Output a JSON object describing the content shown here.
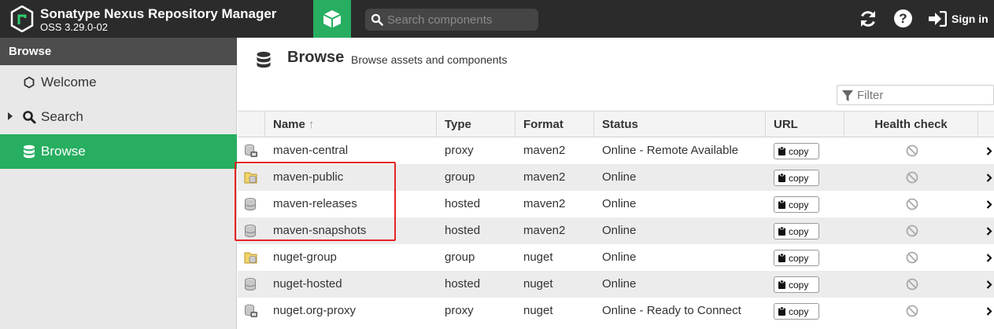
{
  "header": {
    "app_title": "Sonatype Nexus Repository Manager",
    "app_version": "OSS 3.29.0-02",
    "search_placeholder": "Search components",
    "signin_label": "Sign in",
    "help_label": "?",
    "accent_color": "#27ae60",
    "icons": {
      "logo": "nexus-logo-icon",
      "browse_mode": "cube-icon",
      "search": "search-icon",
      "refresh": "refresh-icon",
      "help": "help-icon",
      "signin": "sign-in-icon"
    }
  },
  "sidebar": {
    "header": "Browse",
    "items": [
      {
        "label": "Welcome",
        "icon": "hexagon-icon",
        "active": false
      },
      {
        "label": "Search",
        "icon": "search-icon",
        "active": false,
        "expandable": true
      },
      {
        "label": "Browse",
        "icon": "database-icon",
        "active": true
      }
    ]
  },
  "main": {
    "title": "Browse",
    "subtitle": "Browse assets and components",
    "filter_placeholder": "Filter",
    "columns": [
      "Name",
      "Type",
      "Format",
      "Status",
      "URL",
      "Health check"
    ],
    "sort_indicator": "↑",
    "copy_label": "copy",
    "rows": [
      {
        "name": "maven-central",
        "type": "proxy",
        "format": "maven2",
        "status": "Online - Remote Available",
        "icon": "proxy-repo-icon"
      },
      {
        "name": "maven-public",
        "type": "group",
        "format": "maven2",
        "status": "Online",
        "icon": "group-repo-icon"
      },
      {
        "name": "maven-releases",
        "type": "hosted",
        "format": "maven2",
        "status": "Online",
        "icon": "hosted-repo-icon"
      },
      {
        "name": "maven-snapshots",
        "type": "hosted",
        "format": "maven2",
        "status": "Online",
        "icon": "hosted-repo-icon"
      },
      {
        "name": "nuget-group",
        "type": "group",
        "format": "nuget",
        "status": "Online",
        "icon": "group-repo-icon"
      },
      {
        "name": "nuget-hosted",
        "type": "hosted",
        "format": "nuget",
        "status": "Online",
        "icon": "hosted-repo-icon"
      },
      {
        "name": "nuget.org-proxy",
        "type": "proxy",
        "format": "nuget",
        "status": "Online - Ready to Connect",
        "icon": "proxy-repo-icon"
      }
    ]
  }
}
